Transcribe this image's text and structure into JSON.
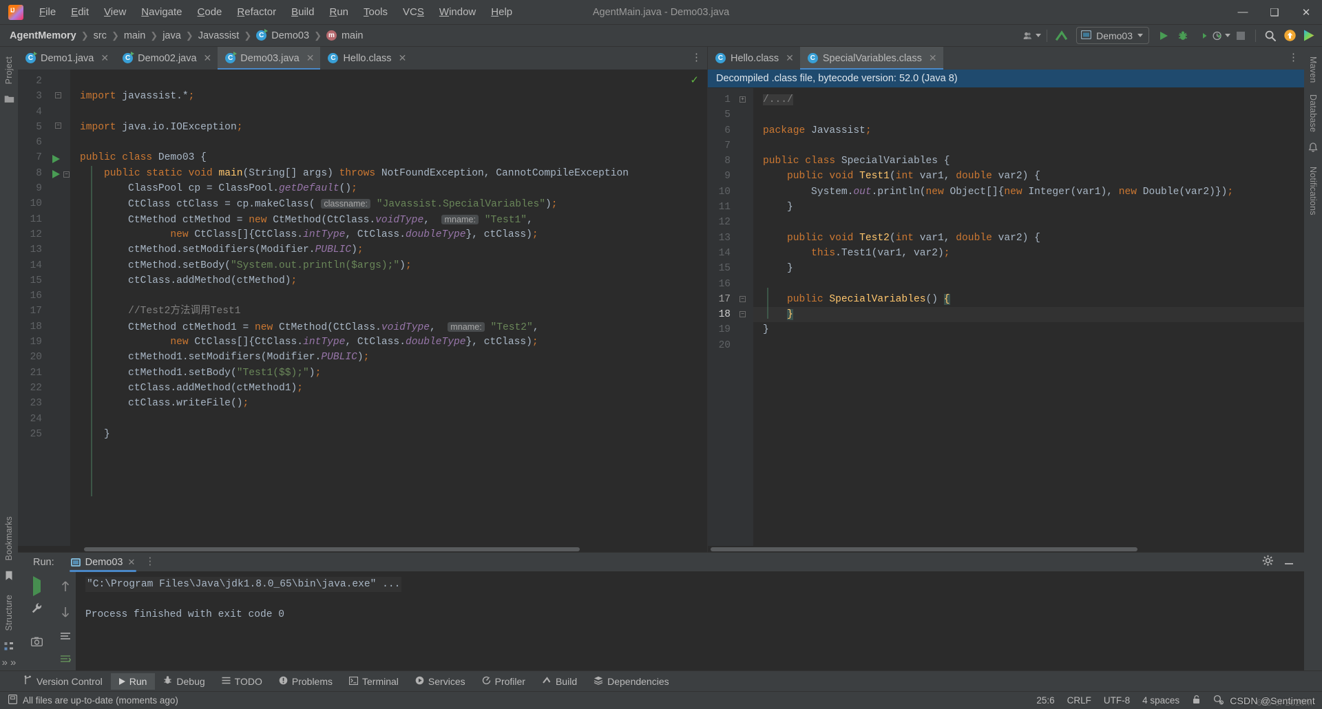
{
  "window": {
    "title": "AgentMain.java - Demo03.java",
    "logo_icon": "intellij-idea-logo",
    "minimize_label": "—",
    "maximize_label": "❑",
    "close_label": "✕"
  },
  "menubar": {
    "items": [
      {
        "label": "File",
        "mnemonic": "F"
      },
      {
        "label": "Edit",
        "mnemonic": "E"
      },
      {
        "label": "View",
        "mnemonic": "V"
      },
      {
        "label": "Navigate",
        "mnemonic": "N"
      },
      {
        "label": "Code",
        "mnemonic": "C"
      },
      {
        "label": "Refactor",
        "mnemonic": "R"
      },
      {
        "label": "Build",
        "mnemonic": "B"
      },
      {
        "label": "Run",
        "mnemonic": "R"
      },
      {
        "label": "Tools",
        "mnemonic": "T"
      },
      {
        "label": "VCS",
        "mnemonic": "S"
      },
      {
        "label": "Window",
        "mnemonic": "W"
      },
      {
        "label": "Help",
        "mnemonic": "H"
      }
    ]
  },
  "navbar": {
    "breadcrumbs": [
      {
        "label": "AgentMemory",
        "icon": "",
        "bold": true
      },
      {
        "label": "src",
        "icon": ""
      },
      {
        "label": "main",
        "icon": ""
      },
      {
        "label": "java",
        "icon": ""
      },
      {
        "label": "Javassist",
        "icon": ""
      },
      {
        "label": "Demo03",
        "icon": "class-icon"
      },
      {
        "label": "main",
        "icon": "method-icon"
      }
    ],
    "separator": "›",
    "account_icon": "user-account-icon",
    "updates_icon": "build-arrow-icon",
    "run_config": {
      "label": "Demo03",
      "icon": "run-config-icon",
      "dropdown": "▾"
    },
    "actions": [
      {
        "name": "run-button",
        "icon": "run-triangle-icon"
      },
      {
        "name": "debug-button",
        "icon": "debug-bug-icon"
      },
      {
        "name": "run-with-coverage-button",
        "icon": "coverage-icon"
      },
      {
        "name": "profiler-button",
        "icon": "profiler-clock-icon"
      },
      {
        "name": "stop-button",
        "icon": "stop-square-icon"
      },
      {
        "name": "search-everywhere-button",
        "icon": "search-icon"
      },
      {
        "name": "update-project-button",
        "icon": "orange-up-arrow-icon"
      },
      {
        "name": "ide-assistant-button",
        "icon": "colorful-play-icon"
      }
    ]
  },
  "left_rail": {
    "items": [
      {
        "label": "Project",
        "icon": "project-tool-icon"
      },
      {
        "label": "",
        "icon": "folder-icon"
      },
      {
        "label": "Bookmarks",
        "icon": "bookmarks-icon"
      },
      {
        "label": "Structure",
        "icon": "structure-icon"
      }
    ]
  },
  "right_rail": {
    "items": [
      {
        "label": "Maven",
        "icon": "maven-icon"
      },
      {
        "label": "Database",
        "icon": "database-icon"
      },
      {
        "label": "Notifications",
        "icon": "notifications-icon"
      }
    ]
  },
  "left_editor": {
    "tabs": [
      {
        "label": "Demo1.java",
        "icon": "java-file-icon",
        "active": false,
        "close": "✕"
      },
      {
        "label": "Demo02.java",
        "icon": "java-file-icon",
        "active": false,
        "close": "✕"
      },
      {
        "label": "Demo03.java",
        "icon": "java-file-icon",
        "active": true,
        "close": "✕"
      },
      {
        "label": "Hello.class",
        "icon": "class-file-icon",
        "active": false,
        "close": "✕"
      }
    ],
    "overflow_icon": "more-options-icon",
    "inspection_status_icon": "inspection-ok-check",
    "first_line_number": 2,
    "lines": [
      {
        "num": 2,
        "text": ""
      },
      {
        "num": 3,
        "text": "import javassist.*;"
      },
      {
        "num": 4,
        "text": ""
      },
      {
        "num": 5,
        "text": "import java.io.IOException;"
      },
      {
        "num": 6,
        "text": ""
      },
      {
        "num": 7,
        "text": "public class Demo03 {"
      },
      {
        "num": 8,
        "text": "    public static void main(String[] args) throws NotFoundException, CannotCompileException"
      },
      {
        "num": 9,
        "text": "        ClassPool cp = ClassPool.getDefault();"
      },
      {
        "num": 10,
        "text": "        CtClass ctClass = cp.makeClass( classname: \"Javassist.SpecialVariables\");"
      },
      {
        "num": 11,
        "text": "        CtMethod ctMethod = new CtMethod(CtClass.voidType,  mname: \"Test1\","
      },
      {
        "num": 12,
        "text": "               new CtClass[]{CtClass.intType, CtClass.doubleType}, ctClass);"
      },
      {
        "num": 13,
        "text": "        ctMethod.setModifiers(Modifier.PUBLIC);"
      },
      {
        "num": 14,
        "text": "        ctMethod.setBody(\"System.out.println($args);\");"
      },
      {
        "num": 15,
        "text": "        ctClass.addMethod(ctMethod);"
      },
      {
        "num": 16,
        "text": ""
      },
      {
        "num": 17,
        "text": "        //Test2方法调用Test1"
      },
      {
        "num": 18,
        "text": "        CtMethod ctMethod1 = new CtMethod(CtClass.voidType,  mname: \"Test2\","
      },
      {
        "num": 19,
        "text": "               new CtClass[]{CtClass.intType, CtClass.doubleType}, ctClass);"
      },
      {
        "num": 20,
        "text": "        ctMethod1.setModifiers(Modifier.PUBLIC);"
      },
      {
        "num": 21,
        "text": "        ctMethod1.setBody(\"Test1($$);\");"
      },
      {
        "num": 22,
        "text": "        ctClass.addMethod(ctMethod1);"
      },
      {
        "num": 23,
        "text": "        ctClass.writeFile();"
      },
      {
        "num": 24,
        "text": ""
      },
      {
        "num": 25,
        "text": "    }"
      }
    ],
    "gutter_run_markers": [
      7,
      8
    ]
  },
  "right_editor": {
    "tabs": [
      {
        "label": "Hello.class",
        "icon": "class-file-icon",
        "active": false,
        "close": "✕"
      },
      {
        "label": "SpecialVariables.class",
        "icon": "class-file-icon",
        "active": true,
        "close": "✕"
      }
    ],
    "overflow_icon": "more-options-icon",
    "banner": "Decompiled .class file, bytecode version: 52.0 (Java 8)",
    "lines": [
      {
        "num": 1,
        "text": "/.../"
      },
      {
        "num": 5,
        "text": ""
      },
      {
        "num": 6,
        "text": "package Javassist;"
      },
      {
        "num": 7,
        "text": ""
      },
      {
        "num": 8,
        "text": "public class SpecialVariables {"
      },
      {
        "num": 9,
        "text": "    public void Test1(int var1, double var2) {"
      },
      {
        "num": 10,
        "text": "        System.out.println(new Object[]{new Integer(var1), new Double(var2)});"
      },
      {
        "num": 11,
        "text": "    }"
      },
      {
        "num": 12,
        "text": ""
      },
      {
        "num": 13,
        "text": "    public void Test2(int var1, double var2) {"
      },
      {
        "num": 14,
        "text": "        this.Test1(var1, var2);"
      },
      {
        "num": 15,
        "text": "    }"
      },
      {
        "num": 16,
        "text": ""
      },
      {
        "num": 17,
        "text": "    public SpecialVariables() {"
      },
      {
        "num": 18,
        "text": "    }"
      },
      {
        "num": 19,
        "text": "}"
      },
      {
        "num": 20,
        "text": ""
      }
    ],
    "caret_line": 18
  },
  "run_panel": {
    "label": "Run:",
    "tab": {
      "label": "Demo03",
      "icon": "run-config-icon",
      "close": "✕"
    },
    "more_icon": "more-options-icon",
    "settings_icon": "gear-icon",
    "hide_icon": "minimize-icon",
    "toolbar_icons": [
      "rerun-icon",
      "up-arrow-icon",
      "wrench-icon",
      "down-arrow-icon",
      "stop-icon",
      "wrap-text-icon",
      "camera-icon",
      "scroll-to-end-icon"
    ],
    "console": {
      "command_line": "\"C:\\Program Files\\Java\\jdk1.8.0_65\\bin\\java.exe\" ...",
      "output_line": "Process finished with exit code 0"
    }
  },
  "tool_window_bar": {
    "items": [
      {
        "label": "Version Control",
        "icon": "branch-icon",
        "active": false
      },
      {
        "label": "Run",
        "icon": "run-triangle-icon",
        "active": true
      },
      {
        "label": "Debug",
        "icon": "debug-bug-icon",
        "active": false
      },
      {
        "label": "TODO",
        "icon": "todo-list-icon",
        "active": false
      },
      {
        "label": "Problems",
        "icon": "problems-icon",
        "active": false
      },
      {
        "label": "Terminal",
        "icon": "terminal-icon",
        "active": false
      },
      {
        "label": "Services",
        "icon": "services-icon",
        "active": false
      },
      {
        "label": "Profiler",
        "icon": "profiler-icon",
        "active": false
      },
      {
        "label": "Build",
        "icon": "build-hammer-icon",
        "active": false
      },
      {
        "label": "Dependencies",
        "icon": "dependencies-icon",
        "active": false
      }
    ]
  },
  "status_bar": {
    "message": "All files are up-to-date (moments ago)",
    "message_icon": "save-indicator-icon",
    "caret_position": "25:6",
    "line_separator": "CRLF",
    "encoding": "UTF-8",
    "indent": "4 spaces",
    "lock_icon": "unlock-icon",
    "inspection_icon": "inspection-settings-icon",
    "watermark": "CSDN @Sentiment",
    "watermark_faint": "693-6f-2020M"
  },
  "colors": {
    "accent_blue": "#4a88c7",
    "run_green": "#499c54",
    "banner_blue": "#1f4a6e",
    "editor_bg": "#2b2b2b",
    "chrome_bg": "#3c3f41",
    "keyword_orange": "#cc7832",
    "string_green": "#6a8759",
    "field_purple": "#9876aa",
    "method_yellow": "#ffc66d"
  }
}
